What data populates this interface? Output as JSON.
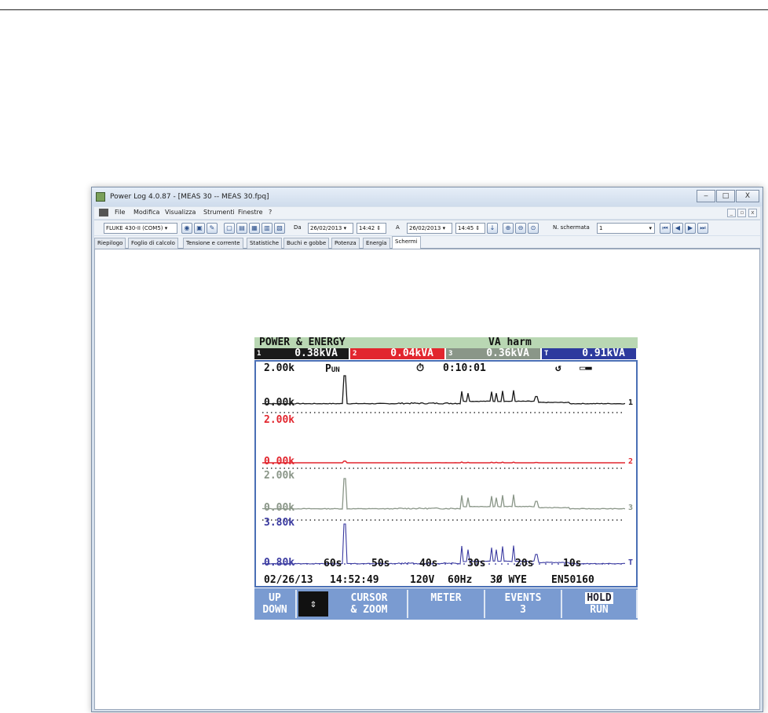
{
  "window": {
    "title": "Power Log 4.0.87 - [MEAS 30 -- MEAS 30.fpq]",
    "min": "‒",
    "max": "□",
    "close": "X"
  },
  "menu": {
    "items": [
      "File",
      "Modifica",
      "Visualizza",
      "Strumenti",
      "Finestre",
      "?"
    ],
    "mdi": [
      "_",
      "▫",
      "x"
    ]
  },
  "toolbar": {
    "device": "FLUKE 430-II (COM5)",
    "from_label": "Da",
    "from_date": "26/02/2013",
    "from_time": "14:42",
    "to_label": "A",
    "to_date": "26/02/2013",
    "to_time": "14:45",
    "screen_label": "N. schermata",
    "screen_value": "1"
  },
  "tabs": [
    "Riepilogo",
    "Foglio di calcolo",
    "Tensione e corrente",
    "Statistiche",
    "Buchi e gobbe",
    "Potenza",
    "Energia",
    "Schermi"
  ],
  "active_tab": "Schermi",
  "screen": {
    "header_title": "POWER & ENERGY",
    "header_mode": "VA harm",
    "readings": [
      {
        "n": "1",
        "v": "0.38kVA",
        "color": "#1a1a1a"
      },
      {
        "n": "2",
        "v": "0.04kVA",
        "color": "#e2262e"
      },
      {
        "n": "3",
        "v": "0.36kVA",
        "color": "#8a9688"
      },
      {
        "n": "T",
        "v": "0.91kVA",
        "color": "#2d3a9e"
      }
    ],
    "status": {
      "scale": "2.00k",
      "label": "P",
      "label_sub": "UN",
      "timer": "0:10:01"
    },
    "traces": [
      {
        "top": "2.00k",
        "bottom": "0.00k",
        "id": "1",
        "color": "#1a1a1a"
      },
      {
        "top": "2.00k",
        "bottom": "0.00k",
        "id": "2",
        "color": "#e2262e"
      },
      {
        "top": "2.00k",
        "bottom": "0.00k",
        "id": "3",
        "color": "#8a9688"
      },
      {
        "top": "3.80k",
        "bottom": "0.80k",
        "id": "T",
        "color": "#3a3aa0"
      }
    ],
    "x_ticks": [
      "60s",
      "50s",
      "40s",
      "30s",
      "20s",
      "10s"
    ],
    "footer": {
      "date": "02/26/13",
      "time": "14:52:49",
      "voltage": "120V",
      "freq": "60Hz",
      "config": "3Ø WYE",
      "standard": "EN50160"
    },
    "buttons": [
      {
        "l1": "UP",
        "l2": "DOWN"
      },
      {
        "l1": "CURSOR",
        "l2": "& ZOOM"
      },
      {
        "l1": "METER",
        "l2": ""
      },
      {
        "l1": "EVENTS",
        "l2": "3"
      },
      {
        "l1": "HOLD",
        "l2": "RUN"
      }
    ]
  }
}
